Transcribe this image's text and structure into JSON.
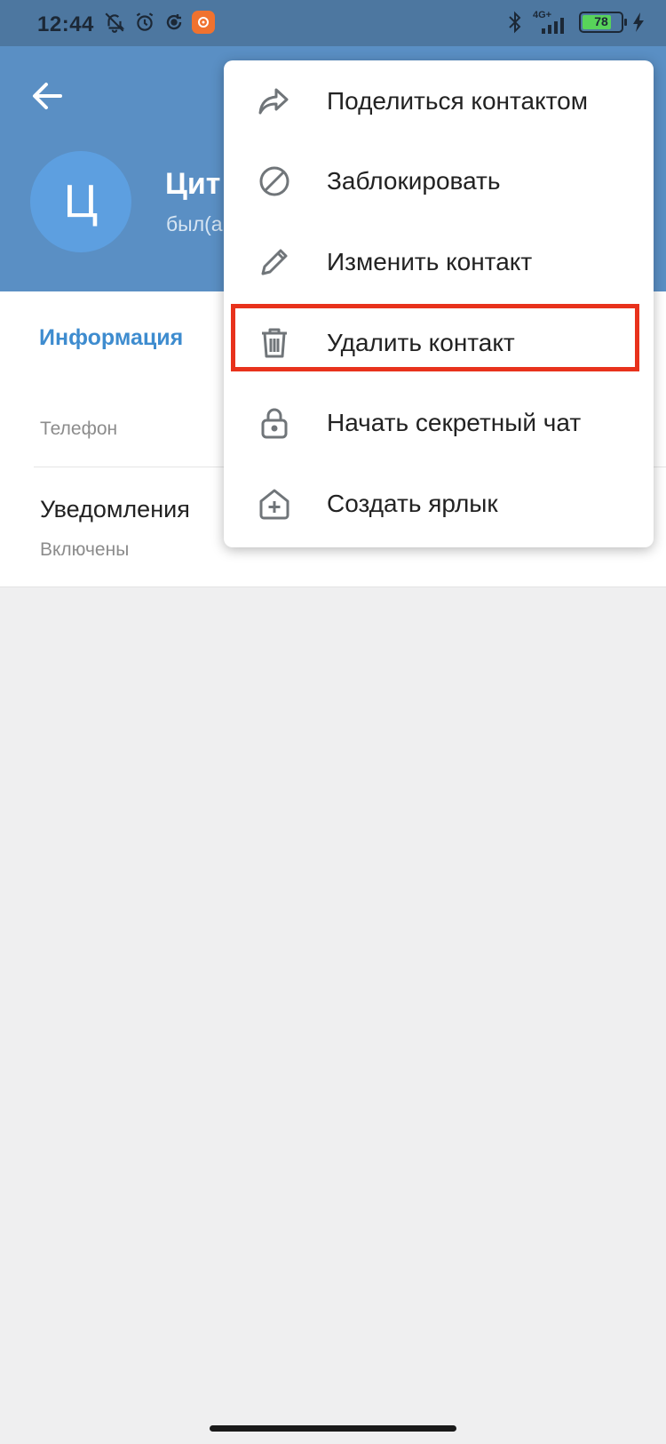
{
  "status_bar": {
    "time": "12:44",
    "network": "4G+",
    "battery": "78",
    "battery_level": 0.78,
    "icons": [
      "muted-bell-icon",
      "alarm-icon",
      "sync-icon",
      "app-notification-icon",
      "bluetooth-icon",
      "signal-icon",
      "charging-icon"
    ]
  },
  "header": {
    "avatar_letter": "Ц",
    "name": "Цит",
    "status": "был(а"
  },
  "info": {
    "heading": "Информация",
    "phone_label": "Телефон",
    "notifications_title": "Уведомления",
    "notifications_value": "Включены"
  },
  "menu": {
    "items": [
      {
        "label": "Поделиться контактом",
        "icon": "share-icon"
      },
      {
        "label": "Заблокировать",
        "icon": "block-icon"
      },
      {
        "label": "Изменить контакт",
        "icon": "pencil-icon"
      },
      {
        "label": "Удалить контакт",
        "icon": "trash-icon",
        "highlighted": true
      },
      {
        "label": "Начать секретный чат",
        "icon": "lock-icon"
      },
      {
        "label": "Создать ярлык",
        "icon": "add-shortcut-icon"
      }
    ]
  },
  "colors": {
    "header": "#5a8fc4",
    "status_bar": "#4d77a0",
    "accent": "#3e8ccf",
    "highlight": "#e8321c",
    "avatar": "#5d9fe0",
    "background": "#efeff0"
  }
}
